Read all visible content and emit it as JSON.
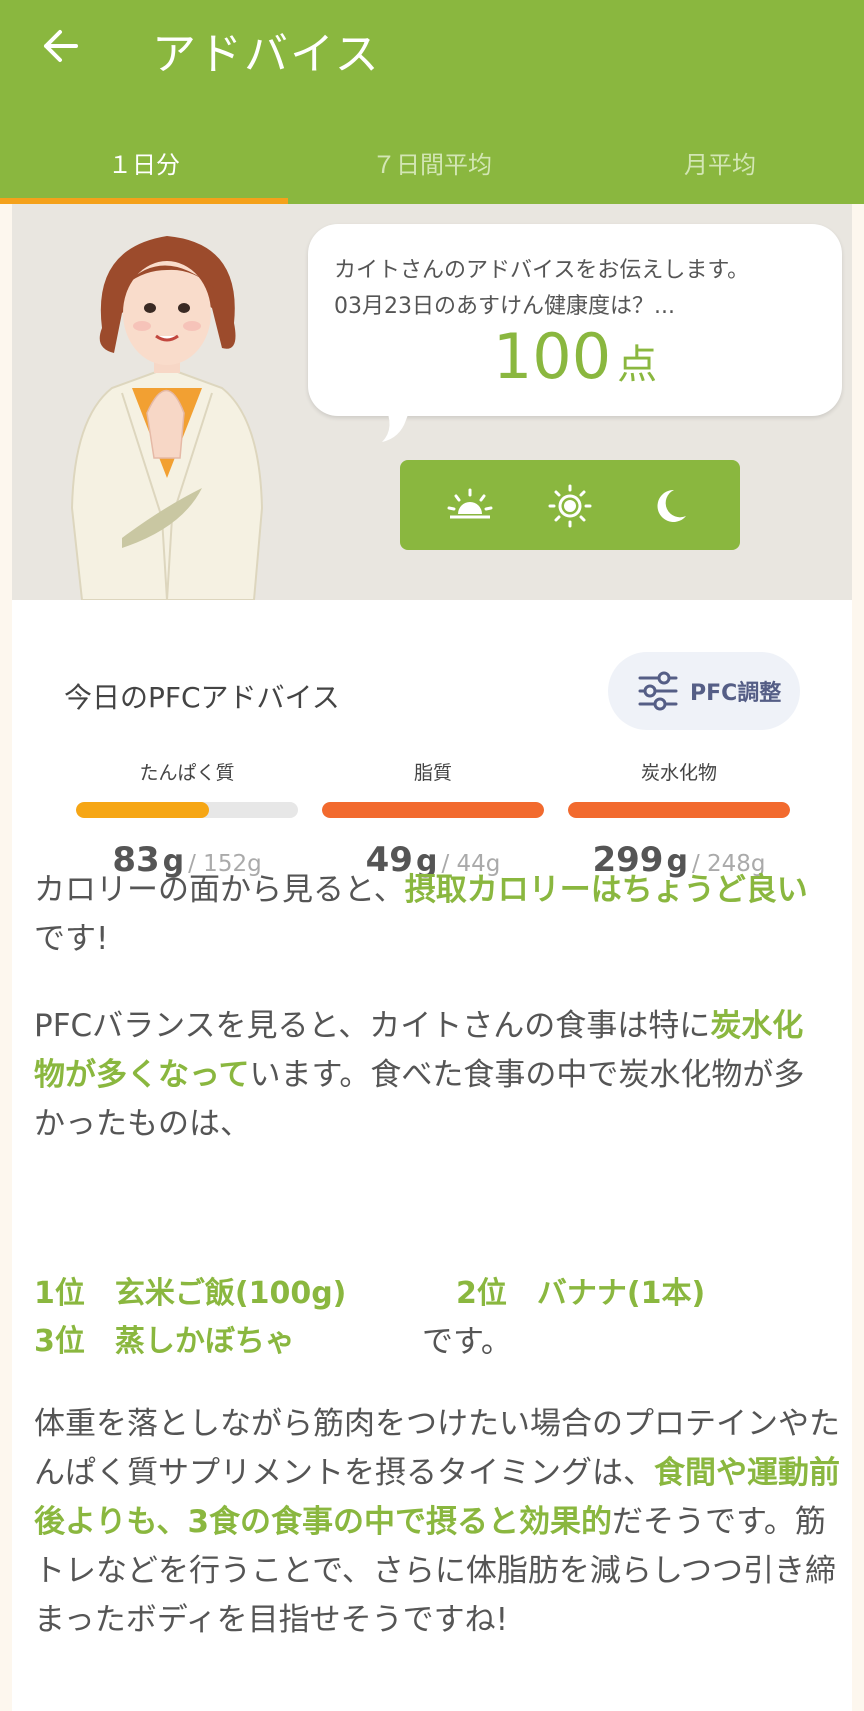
{
  "header": {
    "title": "アドバイス",
    "back_icon": "arrow-left-icon"
  },
  "tabs": [
    {
      "label": "１日分",
      "active": true
    },
    {
      "label": "７日間平均",
      "active": false
    },
    {
      "label": "月平均",
      "active": false
    }
  ],
  "advice": {
    "intro": "カイトさんのアドバイスをお伝えします。",
    "question": "03月23日のあすけん健康度は？...",
    "score": "100",
    "score_unit": "点"
  },
  "meal_icons": [
    "sunrise-icon",
    "sun-icon",
    "moon-icon"
  ],
  "pfc": {
    "title": "今日のPFCアドバイス",
    "adjust_label": "PFC調整",
    "items": [
      {
        "label": "たんぱく質",
        "value": "83",
        "unit": "g",
        "target": "/ 152g",
        "fill_fraction": 0.6,
        "color": "#f6a615"
      },
      {
        "label": "脂質",
        "value": "49",
        "unit": "g",
        "target": "/ 44g",
        "fill_fraction": 1.0,
        "color": "#f26a2e"
      },
      {
        "label": "炭水化物",
        "value": "299",
        "unit": "g",
        "target": "/ 248g",
        "fill_fraction": 1.0,
        "color": "#f26a2e"
      }
    ]
  },
  "paragraphs": {
    "p1_a": "カロリーの面から見ると、",
    "p1_hl": "摂取カロリーはちょうど良い",
    "p1_b": "です!",
    "p2_a": "PFCバランスを見ると、カイトさんの食事は特に",
    "p2_hl": "炭水化物が多くなって",
    "p2_b": "います。食べた食事の中で炭水化物が多かったものは、",
    "rank1": "1位　玄米ご飯(100g)",
    "rank2": "2位　バナナ(1本)",
    "rank3": "3位　蒸しかぼちゃ",
    "rank_suffix": "です。",
    "p3_a": "体重を落としながら筋肉をつけたい場合のプロテインやたんぱく質サプリメントを摂るタイミングは、",
    "p3_hl": "食間や運動前後よりも、3食の食事の中で摂ると効果的",
    "p3_b": "だそうです。筋トレなどを行うことで、さらに体脂肪を減らしつつ引き締まったボディを目指せそうですね!"
  },
  "colors": {
    "brand_green": "#8ab73f",
    "tab_indicator": "#f4a11b"
  }
}
